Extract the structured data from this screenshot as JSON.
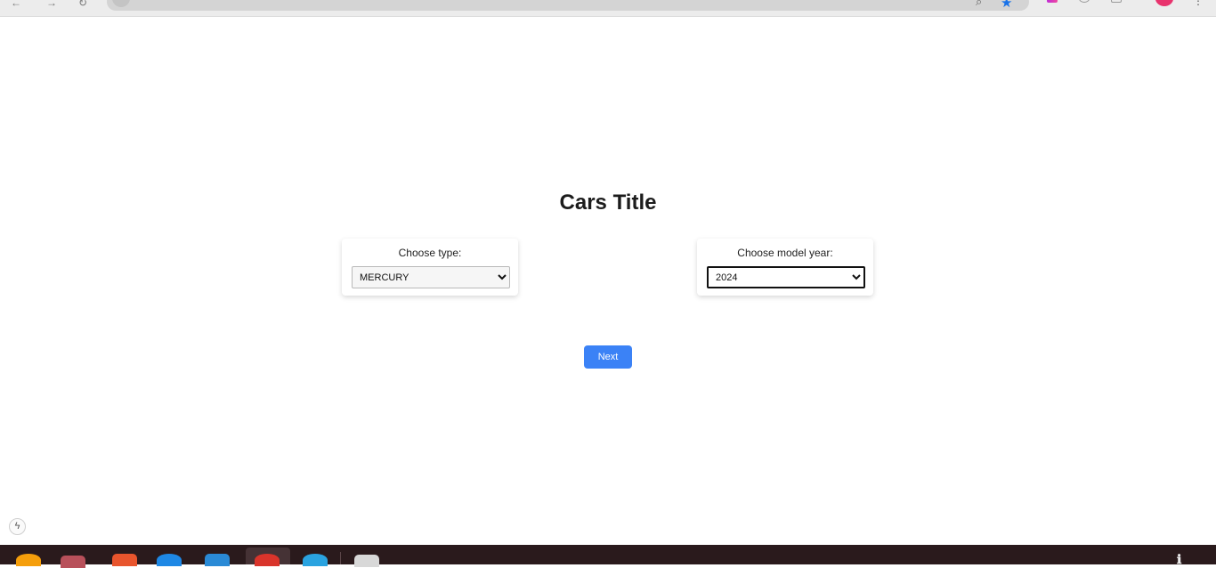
{
  "page": {
    "title": "Cars Title"
  },
  "type_select": {
    "label": "Choose type:",
    "selected": "MERCURY"
  },
  "year_select": {
    "label": "Choose model year:",
    "selected": "2024"
  },
  "actions": {
    "next_label": "Next"
  },
  "colors": {
    "accent": "#3b82f6",
    "taskbar": "#2a1a1c",
    "avatar": "#e8336d"
  },
  "icons": {
    "browser": [
      "back-arrow-icon",
      "forward-arrow-icon",
      "reload-icon",
      "site-info-icon",
      "zoom-icon",
      "bookmark-star-icon",
      "extension-icon",
      "avatar",
      "kebab-menu-icon"
    ],
    "page": [
      "lightning-bolt-icon"
    ],
    "taskbar": [
      "firefox-icon",
      "files-folder-icon",
      "app-store-icon",
      "help-icon",
      "vscode-icon",
      "chrome-icon",
      "telegram-icon",
      "window-icon"
    ]
  }
}
